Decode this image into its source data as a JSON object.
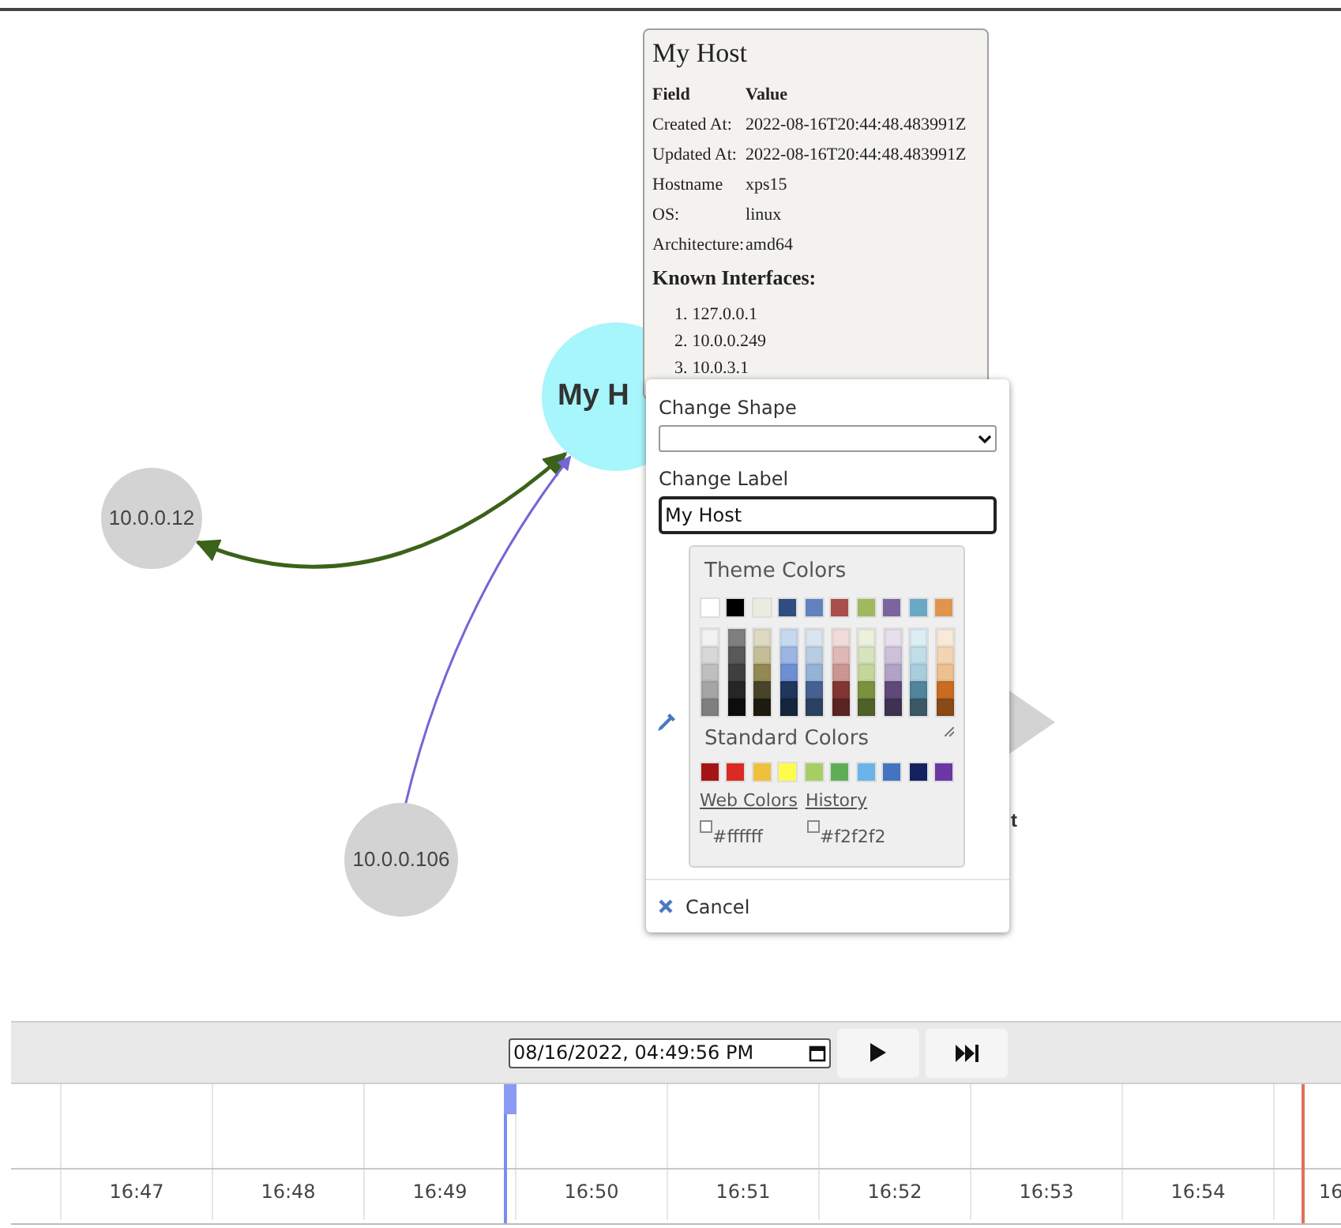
{
  "graph": {
    "nodes": [
      {
        "kind": "host",
        "label": "My H"
      },
      {
        "kind": "circle",
        "label": "10.0.0.12"
      },
      {
        "kind": "circle",
        "label": "10.0.0.106"
      },
      {
        "kind": "triangle",
        "label": "t"
      }
    ],
    "edges": [
      {
        "kind": "both",
        "color": "#3b6219"
      },
      {
        "kind": "single",
        "color": "#7466d6"
      }
    ]
  },
  "tooltip": {
    "title": "My Host",
    "headers": [
      "Field",
      "Value"
    ],
    "rows": [
      [
        "Created At:",
        "2022-08-16T20:44:48.483991Z"
      ],
      [
        "Updated At:",
        "2022-08-16T20:44:48.483991Z"
      ],
      [
        "Hostname",
        "xps15"
      ],
      [
        "OS:",
        "linux"
      ],
      [
        "Architecture:",
        "amd64"
      ]
    ],
    "section": "Known Interfaces:",
    "interfaces": [
      {
        "number": "1.",
        "address": "127.0.0.1"
      },
      {
        "number": "2.",
        "address": "10.0.0.249"
      },
      {
        "number": "3.",
        "address": "10.0.3.1"
      }
    ]
  },
  "editor": {
    "shape_label": "Change Shape",
    "label_label": "Change Label",
    "label_value": "My Host",
    "palette": {
      "theme_title": "Theme Colors",
      "theme": [
        {
          "color": "#ffffff"
        },
        {
          "color": "#000000"
        },
        {
          "color": "#ebebde"
        },
        {
          "color": "#2f4d80"
        },
        {
          "color": "#6282bf"
        },
        {
          "color": "#a94e4a"
        },
        {
          "color": "#a0b85e"
        },
        {
          "color": "#7d649e"
        },
        {
          "color": "#6aa9c6"
        },
        {
          "color": "#e0954e"
        }
      ],
      "shades": [
        {
          "swatches": [
            {
              "color": "#f2f2f2"
            },
            {
              "color": "#d8d8d8"
            },
            {
              "color": "#bfbfbf"
            },
            {
              "color": "#a5a5a5"
            },
            {
              "color": "#7f7f7f"
            }
          ]
        },
        {
          "swatches": [
            {
              "color": "#7f7f7f"
            },
            {
              "color": "#595959"
            },
            {
              "color": "#3f3f3f"
            },
            {
              "color": "#262626"
            },
            {
              "color": "#0c0c0c"
            }
          ]
        },
        {
          "swatches": [
            {
              "color": "#ddd9c3"
            },
            {
              "color": "#c4bd97"
            },
            {
              "color": "#938953"
            },
            {
              "color": "#494429"
            },
            {
              "color": "#1d1b10"
            }
          ]
        },
        {
          "swatches": [
            {
              "color": "#c6d9f0"
            },
            {
              "color": "#9db5e2"
            },
            {
              "color": "#6f8fd4"
            },
            {
              "color": "#1f365d"
            },
            {
              "color": "#17243e"
            }
          ]
        },
        {
          "swatches": [
            {
              "color": "#dbe5f1"
            },
            {
              "color": "#b8cce4"
            },
            {
              "color": "#95b3d7"
            },
            {
              "color": "#466092"
            },
            {
              "color": "#2c4061"
            }
          ]
        },
        {
          "swatches": [
            {
              "color": "#f2dcdb"
            },
            {
              "color": "#e0b9b7"
            },
            {
              "color": "#ca9694"
            },
            {
              "color": "#803734"
            },
            {
              "color": "#5a2423"
            }
          ]
        },
        {
          "swatches": [
            {
              "color": "#ebf1dd"
            },
            {
              "color": "#d7e3bc"
            },
            {
              "color": "#c3d69b"
            },
            {
              "color": "#7a923c"
            },
            {
              "color": "#4f6128"
            }
          ]
        },
        {
          "swatches": [
            {
              "color": "#e5e0ec"
            },
            {
              "color": "#ccc1d9"
            },
            {
              "color": "#b2a2c7"
            },
            {
              "color": "#5f497a"
            },
            {
              "color": "#3f3151"
            }
          ]
        },
        {
          "swatches": [
            {
              "color": "#dbeef3"
            },
            {
              "color": "#c0dde8"
            },
            {
              "color": "#a8cddc"
            },
            {
              "color": "#51859b"
            },
            {
              "color": "#3b5867"
            }
          ]
        },
        {
          "swatches": [
            {
              "color": "#f8ead9"
            },
            {
              "color": "#f3d5b5"
            },
            {
              "color": "#ecc08f"
            },
            {
              "color": "#c96c22"
            },
            {
              "color": "#8a4a16"
            }
          ]
        }
      ],
      "standard_title": "Standard Colors",
      "standard": [
        {
          "color": "#a31515"
        },
        {
          "color": "#db2a23"
        },
        {
          "color": "#efc03c"
        },
        {
          "color": "#fdfc4d"
        },
        {
          "color": "#a6cf63"
        },
        {
          "color": "#5fae55"
        },
        {
          "color": "#6ab4ea"
        },
        {
          "color": "#4274c0"
        },
        {
          "color": "#16215f"
        },
        {
          "color": "#6a37a3"
        }
      ],
      "links": [
        "Web Colors",
        "History"
      ],
      "history": [
        {
          "label": "#ffffff",
          "color": "#ffffff"
        },
        {
          "label": "#f2f2f2",
          "color": "#f2f2f2"
        }
      ]
    },
    "cancel": "Cancel"
  },
  "timeline": {
    "datetime": "08/16/2022, 04:49:56 PM",
    "ticks": [
      "16:47",
      "16:48",
      "16:49",
      "16:50",
      "16:51",
      "16:52",
      "16:53",
      "16:54",
      "16"
    ]
  }
}
